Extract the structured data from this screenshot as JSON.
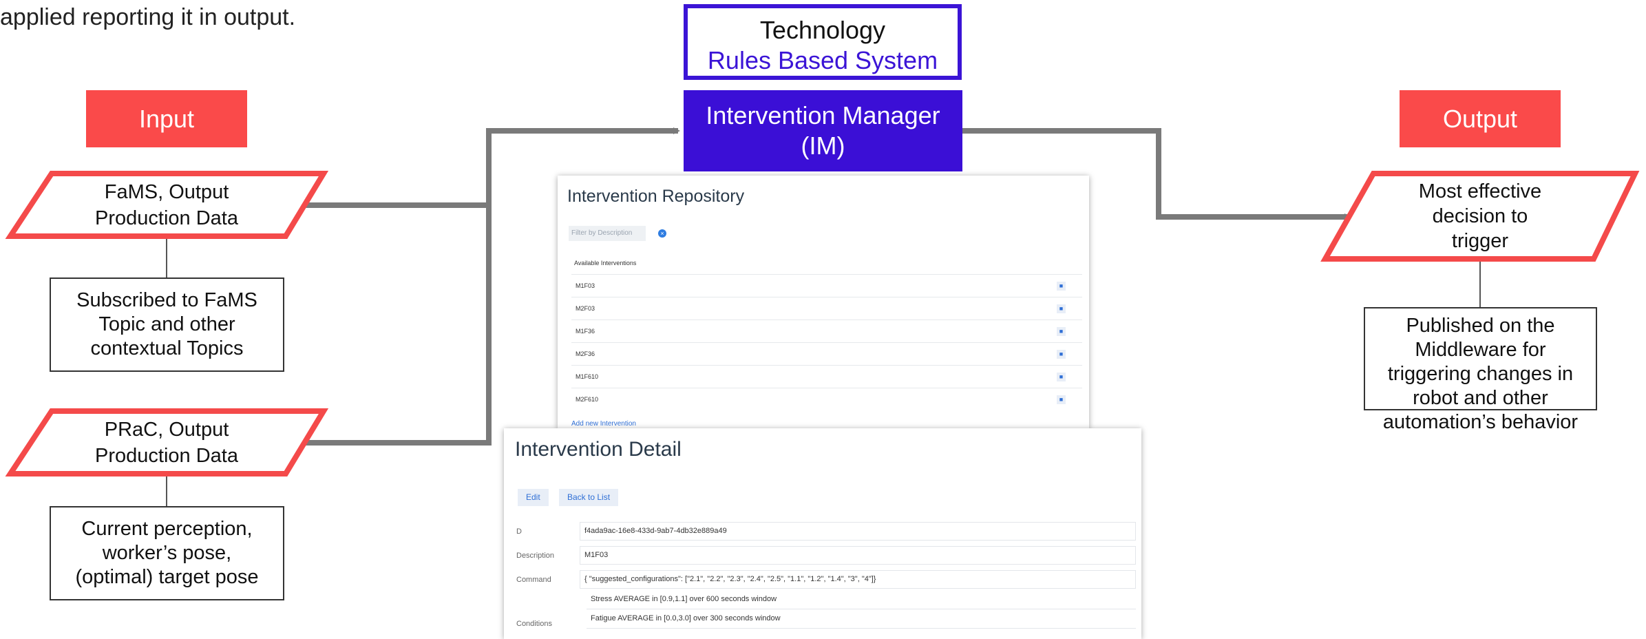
{
  "top_text": "applied reporting it in output.",
  "input_label": "Input",
  "output_label": "Output",
  "fams_shape": [
    "FaMS, Output",
    "Production Data"
  ],
  "prac_shape": [
    "PRaC, Output",
    "Production Data"
  ],
  "output_shape": [
    "Most effective",
    "decision to",
    "trigger"
  ],
  "fams_box": [
    "Subscribed to FaMS",
    "Topic and other",
    "contextual Topics"
  ],
  "prac_box": [
    "Current perception,",
    "worker’s pose,",
    "(optimal) target pose"
  ],
  "output_box": [
    "Published on the",
    "Middleware for",
    "triggering changes in",
    "robot and other",
    "automation’s behavior"
  ],
  "technology": {
    "title": "Technology",
    "subtitle": "Rules Based System"
  },
  "im": [
    "Intervention Manager",
    "(IM)"
  ],
  "repository": {
    "title": "Intervention Repository",
    "filter_placeholder": "Filter by Description",
    "available_label": "Available Interventions",
    "items": [
      "M1F03",
      "M2F03",
      "M1F36",
      "M2F36",
      "M1F610",
      "M2F610"
    ],
    "add_new": "Add new Intervention",
    "trash_icon": "trash-icon",
    "clear_icon": "clear-icon"
  },
  "detail": {
    "title": "Intervention Detail",
    "edit_label": "Edit",
    "back_label": "Back to List",
    "fields": {
      "id_label": "D",
      "id_value": "f4ada9ac-16e8-433d-9ab7-4db32e889a49",
      "description_label": "Description",
      "description_value": "M1F03",
      "command_label": "Command",
      "command_value": "{ \"suggested_configurations\": [\"2.1\", \"2.2\", \"2.3\", \"2.4\", \"2.5\", \"1.1\", \"1.2\", \"1.4\", \"3\", \"4\"]}",
      "conditions_label": "Conditions",
      "condition_1": "Stress AVERAGE in [0.9,1.1] over 600 seconds window",
      "condition_2": "Fatigue AVERAGE in [0.0,3.0] over 300 seconds window"
    }
  },
  "colors": {
    "red": "#fa4a4a",
    "purple": "#3b0fd6",
    "gray_arrow": "#7a7a7a"
  }
}
